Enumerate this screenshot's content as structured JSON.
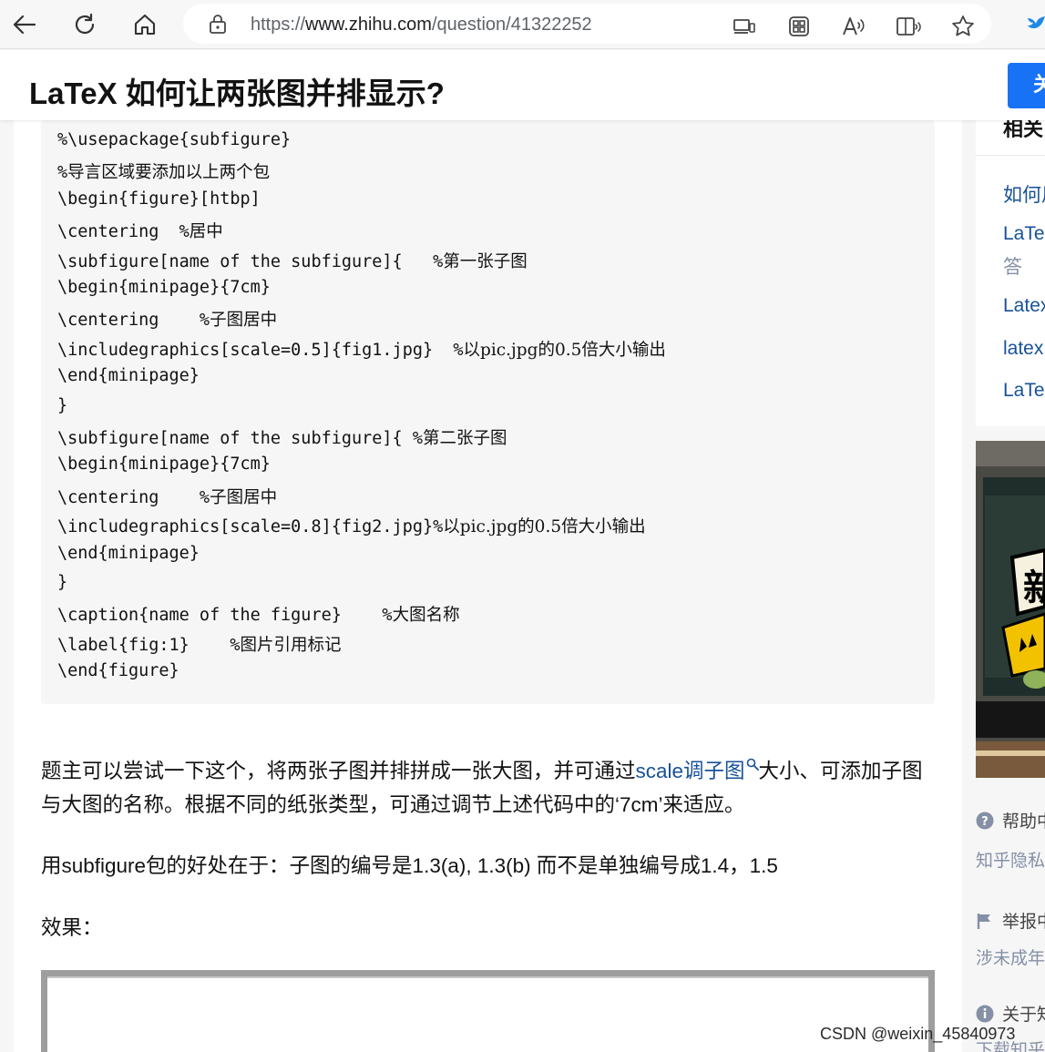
{
  "browser": {
    "url_prefix": "https://",
    "url_host": "www.zhihu.com",
    "url_path": "/question/41322252"
  },
  "header": {
    "title": "LaTeX 如何让两张图并排显示?",
    "follow_button_label": "关",
    "accent_color": "#1772f6"
  },
  "code_lines": [
    {
      "code": "%\\usepackage{subfigure}",
      "comment": ""
    },
    {
      "code": "%",
      "comment": "导言区域要添加以上两个包"
    },
    {
      "code": "\\begin{figure}[htbp]",
      "comment": ""
    },
    {
      "code": "\\centering  %",
      "comment": "居中"
    },
    {
      "code": "\\subfigure[name of the subfigure]{   %",
      "comment": "第一张子图"
    },
    {
      "code": "\\begin{minipage}{7cm}",
      "comment": ""
    },
    {
      "code": "\\centering    %",
      "comment": "子图居中"
    },
    {
      "code": "\\includegraphics[scale=0.5]{fig1.jpg}  %",
      "comment": "以pic.jpg的0.5倍大小输出"
    },
    {
      "code": "\\end{minipage}",
      "comment": ""
    },
    {
      "code": "}",
      "comment": ""
    },
    {
      "code": "\\subfigure[name of the subfigure]{ %",
      "comment": "第二张子图"
    },
    {
      "code": "\\begin{minipage}{7cm}",
      "comment": ""
    },
    {
      "code": "\\centering    %",
      "comment": "子图居中"
    },
    {
      "code": "\\includegraphics[scale=0.8]{fig2.jpg}%",
      "comment": "以pic.jpg的0.5倍大小输出"
    },
    {
      "code": "\\end{minipage}",
      "comment": ""
    },
    {
      "code": "}",
      "comment": ""
    },
    {
      "code": "\\caption{name of the figure}    %",
      "comment": "大图名称"
    },
    {
      "code": "\\label{fig:1}    %",
      "comment": "图片引用标记"
    },
    {
      "code": "\\end{figure}",
      "comment": ""
    }
  ],
  "answer": {
    "para1_before_link": "题主可以尝试一下这个，将两张子图并排拼成一张大图，并可通过",
    "para1_link": "scale调子图",
    "para1_after_link": "大小、可添加子图",
    "para1_line2": "与大图的名称。根据不同的纸张类型，可通过调节上述代码中的‘7cm’来适应。",
    "para2": "用subfigure包的好处在于：子图的编号是1.3(a), 1.3(b) 而不是单独编号成1.4，1.5",
    "para3": "效果："
  },
  "sidebar": {
    "heading": "相关",
    "links": [
      {
        "text": "如何用"
      },
      {
        "text": "LaTeX",
        "sub": "答"
      },
      {
        "text": "Latex"
      },
      {
        "text": "latex"
      },
      {
        "text": "LaTeX"
      }
    ]
  },
  "ad": {
    "glyph": "新"
  },
  "footer": {
    "help_label": "帮助中",
    "help_sub": "知乎隐私",
    "report_label": "举报中",
    "report_sub": "涉未成年",
    "about_label": "关于知",
    "about_sub": "下载知乎"
  },
  "watermark": "CSDN @weixin_45840973"
}
